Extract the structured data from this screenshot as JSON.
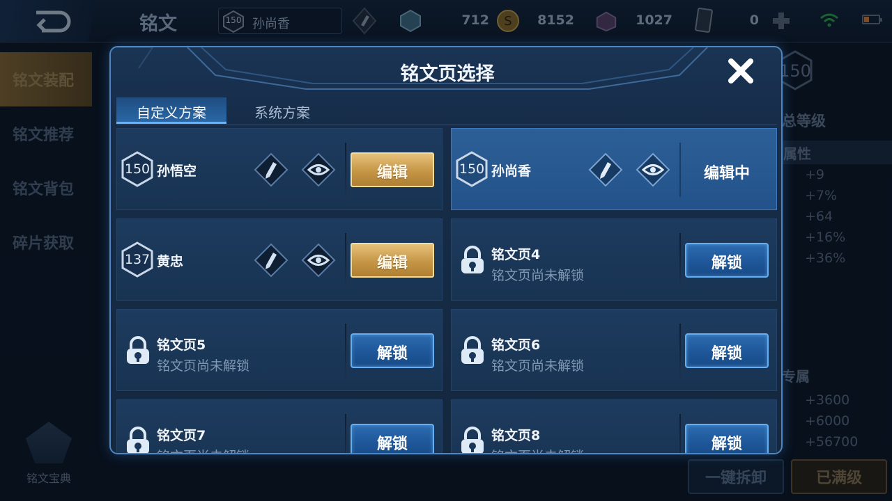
{
  "header": {
    "title": "铭文",
    "hero_level": "150",
    "hero_name": "孙尚香",
    "currencies": [
      {
        "name": "gem-icon",
        "value": "712"
      },
      {
        "name": "gold-coin-icon",
        "value": "8152"
      },
      {
        "name": "crystal-box-icon",
        "value": "1027"
      },
      {
        "name": "card-icon",
        "value": "0"
      }
    ]
  },
  "sidebar": {
    "items": [
      {
        "label": "铭文装配",
        "active": true
      },
      {
        "label": "铭文推荐",
        "active": false
      },
      {
        "label": "铭文背包",
        "active": false
      },
      {
        "label": "碎片获取",
        "active": false
      }
    ],
    "codex_label": "铭文宝典"
  },
  "right_panel": {
    "level": "150",
    "total_level_label": "总等级",
    "attr_header": "属性",
    "stats": [
      "+9",
      "+7%",
      "+64",
      "+16%",
      "+36%"
    ],
    "exclusive_header": "专属",
    "exclusive_stats": [
      "+3600",
      "+6000",
      "+56700"
    ],
    "unload_label": "一键拆卸",
    "maxed_label": "已满级"
  },
  "modal": {
    "title": "铭文页选择",
    "tabs": [
      {
        "label": "自定义方案",
        "active": true
      },
      {
        "label": "系统方案",
        "active": false
      }
    ],
    "pages": [
      {
        "level": "150",
        "hero": "孙悟空",
        "action": "编辑"
      },
      {
        "level": "150",
        "hero": "孙尚香",
        "status": "编辑中"
      },
      {
        "level": "137",
        "hero": "黄忠",
        "action": "编辑"
      },
      {
        "name": "铭文页4",
        "sub": "铭文页尚未解锁",
        "action": "解锁"
      },
      {
        "name": "铭文页5",
        "sub": "铭文页尚未解锁",
        "action": "解锁"
      },
      {
        "name": "铭文页6",
        "sub": "铭文页尚未解锁",
        "action": "解锁"
      },
      {
        "name": "铭文页7",
        "sub": "铭文页尚未解锁",
        "action": "解锁"
      },
      {
        "name": "铭文页8",
        "sub": "铭文页尚未解锁",
        "action": "解锁"
      }
    ]
  },
  "colors": {
    "accent_blue": "#4f86c0",
    "gold_button": "#c59645",
    "blue_button": "#1d5597"
  }
}
